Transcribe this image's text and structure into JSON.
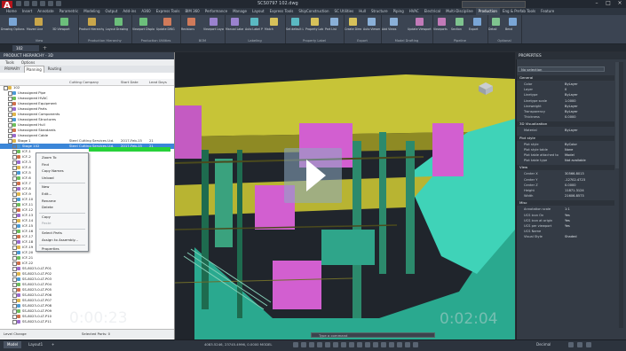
{
  "app": {
    "icon_letter": "A",
    "title": "SCS0797  102.dwg",
    "search_placeholder": "Type a keyword or phrase",
    "account": "Sign In"
  },
  "ribbon_tabs": [
    "Home",
    "Insert",
    "Annotate",
    "Parametric",
    "Modeling",
    "Output",
    "Add-ins",
    "A360",
    "Express Tools",
    "BIM 360",
    "Performance",
    "Manage",
    "Layout",
    "Express Tools",
    "ShipConstruction",
    "SC Utilities",
    "Hull",
    "Structure",
    "Piping",
    "HVAC",
    "Electrical",
    "Multi-Discipline",
    "Production",
    "Eng & Prefab Tools",
    "Feature"
  ],
  "ribbon": {
    "panels": [
      {
        "label": "View",
        "buttons": [
          "Drawing Options",
          "Moved Line",
          "3D Viewport"
        ]
      },
      {
        "label": "Production Hierarchy",
        "buttons": [
          "Product Hierarchy",
          "Layout Drawing"
        ]
      },
      {
        "label": "Production Utilities",
        "buttons": [
          "Viewport Display Options",
          "Update DWG"
        ]
      },
      {
        "label": "BOM",
        "buttons": [
          "Revisions",
          "Viewport Layout"
        ]
      },
      {
        "label": "Labeling",
        "buttons": [
          "Manual Label",
          "Auto Label Part",
          "Match"
        ]
      },
      {
        "label": "Property Label",
        "buttons": [
          "Set default Location",
          "Property Label",
          "Part List"
        ]
      },
      {
        "label": "Export",
        "buttons": [
          "Create Dimension",
          "Auto Viewer"
        ]
      },
      {
        "label": "Model Drafting",
        "buttons": [
          "Add Views",
          "Update Viewport"
        ]
      },
      {
        "label": "Pipeline",
        "buttons": [
          "Viewports",
          "Section",
          "Export"
        ]
      },
      {
        "label": "Optional",
        "buttons": [
          "Detail",
          "Bend"
        ]
      }
    ]
  },
  "doc_tab": "102",
  "palette": {
    "title": "PRODUCT HIERARCHY - 3D",
    "menus": [
      "Tools",
      "Options"
    ],
    "tabs": [
      "PRIMARY",
      "Planning",
      "Routing"
    ],
    "columns": [
      "Cutting Company",
      "Start Date",
      "Lead Days"
    ],
    "tree": [
      {
        "label": "102",
        "level": 0
      },
      {
        "label": "Unassigned Pipe",
        "level": 1
      },
      {
        "label": "Unassigned HVAC",
        "level": 1
      },
      {
        "label": "Unassigned Equipment",
        "level": 1
      },
      {
        "label": "Unassigned Parts",
        "level": 1
      },
      {
        "label": "Unassigned Components",
        "level": 1
      },
      {
        "label": "Unassigned Structures",
        "level": 1
      },
      {
        "label": "Unassigned Hull",
        "level": 1
      },
      {
        "label": "Unassigned Standards",
        "level": 1
      },
      {
        "label": "Unassigned Cable",
        "level": 1
      },
      {
        "label": "Stage 1",
        "level": 1,
        "cc": "Steel Cutting Services Ltd.",
        "sd": "2017-Feb-15",
        "ld": "21"
      },
      {
        "label": "Stage 102",
        "level": 2,
        "cc": "Steel Cutting Services Ltd.",
        "sd": "2017-Feb-15",
        "ld": "21",
        "selected": true
      },
      {
        "label": "ICF-1",
        "level": 2
      },
      {
        "label": "ICF-2",
        "level": 2
      },
      {
        "label": "ICF-3",
        "level": 2
      },
      {
        "label": "ICF-4",
        "level": 2
      },
      {
        "label": "ICF-5",
        "level": 2
      },
      {
        "label": "ICF-6",
        "level": 2
      },
      {
        "label": "ICF-7",
        "level": 2
      },
      {
        "label": "ICF-8",
        "level": 2
      },
      {
        "label": "ICF-9",
        "level": 2
      },
      {
        "label": "ICF-10",
        "level": 2
      },
      {
        "label": "ICF-11",
        "level": 2
      },
      {
        "label": "ICF-12",
        "level": 2
      },
      {
        "label": "ICF-13",
        "level": 2
      },
      {
        "label": "ICF-14",
        "level": 2
      },
      {
        "label": "ICF-15",
        "level": 2
      },
      {
        "label": "ICF-16",
        "level": 2
      },
      {
        "label": "ICF-17",
        "level": 2
      },
      {
        "label": "ICF-18",
        "level": 2
      },
      {
        "label": "ICF-19",
        "level": 2
      },
      {
        "label": "ICF-20",
        "level": 2
      },
      {
        "label": "ICF-21",
        "level": 2
      },
      {
        "label": "ICF-22",
        "level": 2
      },
      {
        "label": "SS-8023-0-LT-P01",
        "level": 2
      },
      {
        "label": "SS-8023-0-LT-P02",
        "level": 2
      },
      {
        "label": "SS-8023-0-LT-P03",
        "level": 2
      },
      {
        "label": "SS-8023-0-LT-P04",
        "level": 2
      },
      {
        "label": "SS-8023-0-LT-P05",
        "level": 2
      },
      {
        "label": "SS-8023-0-LT-P06",
        "level": 2
      },
      {
        "label": "SS-8023-0-LT-P07",
        "level": 2
      },
      {
        "label": "SS-8023-0-LT-P08",
        "level": 2
      },
      {
        "label": "SS-8023-0-LT-P09",
        "level": 2
      },
      {
        "label": "SS-8023-0-LT-P10",
        "level": 2
      },
      {
        "label": "SS-8023-0-LT-P11",
        "level": 2
      }
    ],
    "context_menu": [
      {
        "label": "Zoom To",
        "disabled": false
      },
      {
        "label": "Find",
        "disabled": false
      },
      {
        "label": "Copy Names",
        "disabled": false
      },
      {
        "label": "Unload",
        "disabled": false
      },
      {
        "sep": true
      },
      {
        "label": "New",
        "disabled": false
      },
      {
        "label": "Edit...",
        "disabled": false
      },
      {
        "label": "Rename",
        "disabled": false
      },
      {
        "label": "Delete",
        "disabled": false
      },
      {
        "sep": true
      },
      {
        "label": "Copy",
        "disabled": false
      },
      {
        "label": "Paste",
        "disabled": true
      },
      {
        "sep": true
      },
      {
        "label": "Select Parts",
        "disabled": false
      },
      {
        "label": "Assign to Assembly...",
        "disabled": false
      },
      {
        "sep": true
      },
      {
        "label": "Properties",
        "disabled": false
      }
    ],
    "status_left": "Level Change",
    "status_right": "Selected Parts: 0"
  },
  "video": {
    "time_left": "0:00:23",
    "time_right": "0:02:04"
  },
  "command_line_placeholder": "Type a command",
  "properties": {
    "title": "PROPERTIES",
    "selection": "No selection",
    "sections": [
      {
        "name": "General",
        "rows": [
          [
            "Color",
            "ByLayer"
          ],
          [
            "Layer",
            "0"
          ],
          [
            "Linetype",
            "ByLayer"
          ],
          [
            "Linetype scale",
            "1.0000"
          ],
          [
            "Lineweight",
            "ByLayer"
          ],
          [
            "Transparency",
            "ByLayer"
          ],
          [
            "Thickness",
            "0.0000"
          ]
        ]
      },
      {
        "name": "3D Visualization",
        "rows": [
          [
            "Material",
            "ByLayer"
          ]
        ]
      },
      {
        "name": "Plot style",
        "rows": [
          [
            "Plot style",
            "ByColor"
          ],
          [
            "Plot style table",
            "None"
          ],
          [
            "Plot table attached to",
            "Model"
          ],
          [
            "Plot table type",
            "Not available"
          ]
        ]
      },
      {
        "name": "View",
        "rows": [
          [
            "Center X",
            "30566.8013"
          ],
          [
            "Center Y",
            "-12702.4723"
          ],
          [
            "Center Z",
            "0.0000"
          ],
          [
            "Height",
            "11871.3124"
          ],
          [
            "Width",
            "21606.8573"
          ]
        ]
      },
      {
        "name": "Misc",
        "rows": [
          [
            "Annotation scale",
            "1:1"
          ],
          [
            "UCS icon On",
            "Yes"
          ],
          [
            "UCS icon at origin",
            "Yes"
          ],
          [
            "UCS per viewport",
            "Yes"
          ],
          [
            "UCS Name",
            ""
          ],
          [
            "Visual Style",
            "Shaded"
          ]
        ]
      }
    ]
  },
  "statusbar": {
    "tabs": [
      "Model",
      "Layout1",
      "+"
    ],
    "coords": "4083.5246, 23745.4996, 0.0000   MODEL",
    "units": "Decimal"
  },
  "colors": {
    "accent_green": "#28d13b",
    "selection_blue": "#3b86d8",
    "hull_teal": "#3fd3b8",
    "deck_olive": "#c7c437",
    "bulkhead_magenta": "#d25fd0",
    "app_red": "#b8141b"
  }
}
